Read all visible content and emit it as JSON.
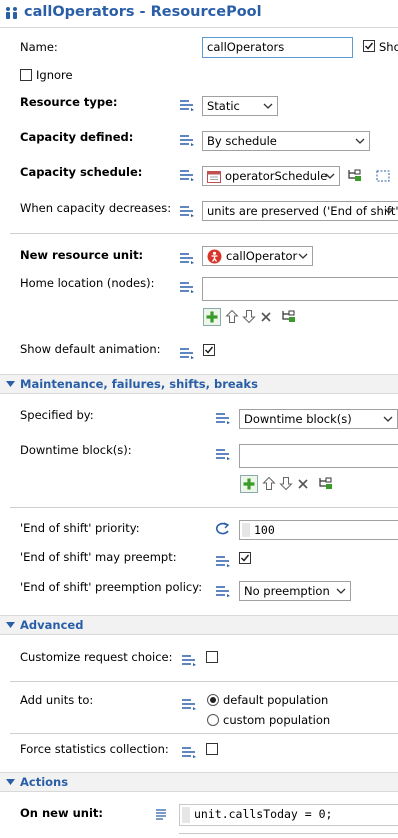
{
  "window": {
    "title": "callOperators - ResourcePool"
  },
  "name": {
    "label": "Name:",
    "value": "callOperators",
    "show_label": "Sho"
  },
  "ignore": {
    "label": "Ignore"
  },
  "resource_type": {
    "label": "Resource type:",
    "value": "Static"
  },
  "capacity_defined": {
    "label": "Capacity defined:",
    "value": "By schedule"
  },
  "capacity_schedule": {
    "label": "Capacity schedule:",
    "value": "operatorSchedule"
  },
  "capacity_decreases": {
    "label": "When capacity decreases:",
    "value": "units are preserved ('End of shift')"
  },
  "new_resource_unit": {
    "label": "New resource unit:",
    "value": "callOperator"
  },
  "home_location": {
    "label": "Home location (nodes):",
    "value": ""
  },
  "show_animation": {
    "label": "Show default animation:",
    "checked": true
  },
  "section_maintenance": {
    "title": "Maintenance, failures, shifts, breaks"
  },
  "specified_by": {
    "label": "Specified by:",
    "value": "Downtime block(s)"
  },
  "downtime_blocks": {
    "label": "Downtime block(s):",
    "value": ""
  },
  "eos_priority": {
    "label": "'End of shift' priority:",
    "value": "100"
  },
  "eos_preempt": {
    "label": "'End of shift' may preempt:",
    "checked": true
  },
  "eos_policy": {
    "label": "'End of shift' preemption policy:",
    "value": "No preemption"
  },
  "section_advanced": {
    "title": "Advanced"
  },
  "customize_choice": {
    "label": "Customize request choice:",
    "checked": false
  },
  "add_units": {
    "label": "Add units to:",
    "options": [
      "default population",
      "custom population"
    ],
    "selected": 0
  },
  "force_stats": {
    "label": "Force statistics collection:",
    "checked": false
  },
  "section_actions": {
    "title": "Actions"
  },
  "on_new_unit": {
    "label": "On new unit:",
    "code": "unit.callsToday = 0;"
  },
  "colors": {
    "accent": "#2a5fa8",
    "focus_border": "#5b9bd5",
    "add_green": "#3a9b2a",
    "agent_red": "#d9342b"
  }
}
